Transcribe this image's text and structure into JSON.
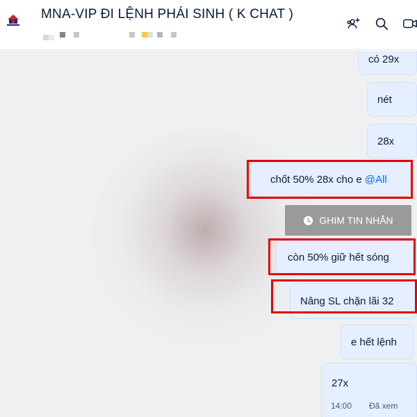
{
  "header": {
    "title": "MNA-VIP ĐI LỆNH PHÁI SINH ( K CHAT )",
    "icons": [
      "group-add-icon",
      "search-icon",
      "video-call-icon"
    ]
  },
  "messages": [
    {
      "text": "có 29x"
    },
    {
      "text": "nét"
    },
    {
      "text": "28x"
    },
    {
      "text": "chốt 50% 28x cho e ",
      "mention": "@All"
    },
    {
      "text": "còn 50% giữ hết sóng"
    },
    {
      "text": "Nâng SL chặn lãi 32"
    },
    {
      "text": "e hết lệnh"
    },
    {
      "text": "27x",
      "time": "14:00",
      "status": "Đã xem"
    }
  ],
  "pin_button": {
    "label": "GHIM TIN NHẮN"
  },
  "colors": {
    "bubble_bg": "#e5efff",
    "mention": "#0068ff",
    "highlight": "#e60000",
    "pin_bg": "#9a9a9a"
  }
}
